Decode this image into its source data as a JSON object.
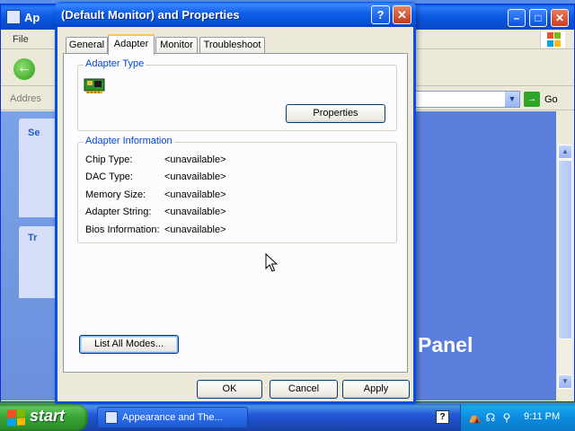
{
  "background_window": {
    "title": "Ap",
    "menu_file": "File",
    "address_label": "Addres",
    "go_label": "Go",
    "task_heads": [
      "Se",
      "Tr"
    ],
    "panel_text": "Panel"
  },
  "dialog": {
    "title": "(Default Monitor) and  Properties",
    "tabs": [
      "General",
      "Adapter",
      "Monitor",
      "Troubleshoot"
    ],
    "active_tab": "Adapter",
    "adapter_type": {
      "label": "Adapter Type",
      "properties_button": "Properties"
    },
    "adapter_info": {
      "label": "Adapter Information",
      "rows": [
        {
          "key": "Chip Type:",
          "value": "<unavailable>"
        },
        {
          "key": "DAC Type:",
          "value": "<unavailable>"
        },
        {
          "key": "Memory Size:",
          "value": "<unavailable>"
        },
        {
          "key": "Adapter String:",
          "value": "<unavailable>"
        },
        {
          "key": "Bios Information:",
          "value": "<unavailable>"
        }
      ]
    },
    "list_modes_button": "List All Modes...",
    "ok_button": "OK",
    "cancel_button": "Cancel",
    "apply_button": "Apply"
  },
  "taskbar": {
    "start_label": "start",
    "task_button_label": "Appearance and The...",
    "clock": "9:11 PM"
  },
  "colors": {
    "titlebar_blue": "#0a5ae8",
    "close_red": "#c3391b",
    "group_label_blue": "#0046d5",
    "active_tab_highlight": "#ffc83c",
    "start_green": "#37a335"
  },
  "icons": [
    "help-icon",
    "close-icon",
    "adapter-card-icon",
    "back-arrow-icon",
    "windows-logo-icon",
    "go-arrow-icon",
    "mouse-cursor-icon"
  ]
}
